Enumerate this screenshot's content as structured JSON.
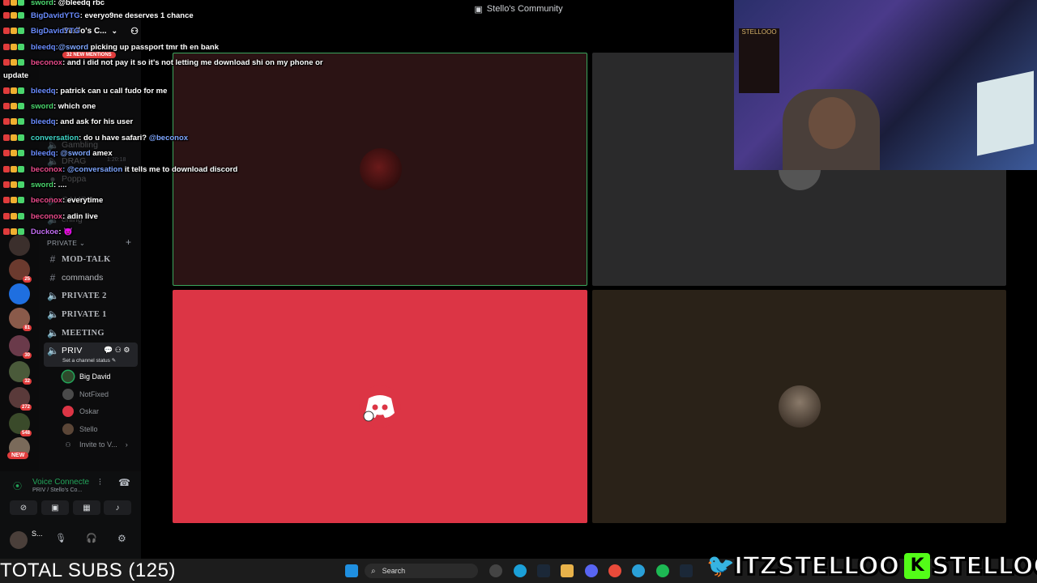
{
  "window": {
    "title": "Stello's Community"
  },
  "server": {
    "name": "Stello's C..."
  },
  "mentions_pill": "32 NEW MENTIONS",
  "rail_badges": [
    "25",
    "81",
    "30",
    "32",
    "272",
    "548"
  ],
  "rail_new": "NEW",
  "channels": {
    "faded": [
      "Gambling",
      "DRAG",
      "Poppa",
      "GAMBLI...",
      "ening"
    ],
    "drag_time": "1:20:18",
    "category": "PRIVATE",
    "items": [
      {
        "label": "MOD-TALK",
        "kind": "text"
      },
      {
        "label": "commands",
        "kind": "text"
      },
      {
        "label": "PRIVATE 2",
        "kind": "voice"
      },
      {
        "label": "PRIVATE 1",
        "kind": "voice"
      },
      {
        "label": "MEETING",
        "kind": "voice"
      },
      {
        "label": "PRIV",
        "kind": "voice",
        "active": true
      }
    ],
    "status_hint": "Set a channel status",
    "users": [
      {
        "name": "Big David",
        "speaking": true,
        "color": "#2f4a2c"
      },
      {
        "name": "NotFixed",
        "speaking": false,
        "color": "#4a4a4a"
      },
      {
        "name": "Oskar",
        "speaking": false,
        "color": "#dc3545"
      },
      {
        "name": "Stello",
        "speaking": false,
        "color": "#5b4637"
      }
    ],
    "invite": "Invite to V..."
  },
  "voice_panel": {
    "title": "Voice Connecte",
    "subtitle": "PRIV / Stello's Co...",
    "user_initial": "S..."
  },
  "chat": [
    {
      "user": "sword",
      "color": "#4ad66d",
      "text": ": @bleedq rbc"
    },
    {
      "user": "BigDavidYTG",
      "color": "#6a8cff",
      "text": ": everyo9ne deserves 1 chance"
    },
    {
      "user": "BigDavidYTG",
      "color": "#6a8cff",
      "text": ""
    },
    {
      "user": "bleedq",
      "color": "#6a8cff",
      "mention": ":@sword",
      "text": " picking up passport tmr th en bank"
    },
    {
      "user": "beconox",
      "color": "#e84a8a",
      "text": ": and i did not pay it so it's not letting me download shi on my phone or"
    },
    {
      "user": "",
      "color": "#fff",
      "text": "update",
      "noindent": true
    },
    {
      "user": "bleedq",
      "color": "#6a8cff",
      "text": ": patrick can u call fudo for me"
    },
    {
      "user": "sword",
      "color": "#4ad66d",
      "text": ": which one"
    },
    {
      "user": "bleedq",
      "color": "#6a8cff",
      "text": ": and ask for his user"
    },
    {
      "user": "conversation",
      "color": "#3fd6c8",
      "text": ": do u have safari?",
      "mention_after": " @beconox"
    },
    {
      "user": "bleedq",
      "color": "#6a8cff",
      "mention": ": @sword",
      "text": " amex"
    },
    {
      "user": "beconox",
      "color": "#e84a8a",
      "mention": ": @conversation",
      "text": " it tells me to download discord"
    },
    {
      "user": "sword",
      "color": "#4ad66d",
      "text": ": ...."
    },
    {
      "user": "beconox",
      "color": "#e84a8a",
      "text": ": everytime"
    },
    {
      "user": "beconox",
      "color": "#e84a8a",
      "text": ": adin live"
    },
    {
      "user": "Duckoe",
      "color": "#c06cf0",
      "text": ": 😈"
    }
  ],
  "taskbar": {
    "subs": "TOTAL SUBS (125)",
    "search": "Search"
  },
  "socials": {
    "twitter": "ITZSTELLOO",
    "kick": "STELLOOO"
  },
  "webcam": {
    "sign_text": "STELLOOO"
  }
}
